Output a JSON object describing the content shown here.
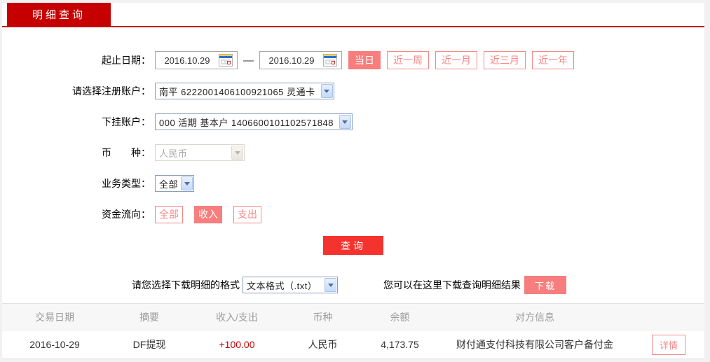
{
  "colors": {
    "tab_red": "#c60001",
    "query_red": "#f5332e",
    "salmon": "#f87e7e",
    "amount_red": "#c00000",
    "header_gray": "#9c9c9c"
  },
  "tab": {
    "label": "明细查询"
  },
  "form": {
    "date_range": {
      "label": "起止日期：",
      "start": "2016.10.29",
      "end": "2016.10.29",
      "separator": "—",
      "quick_buttons": [
        {
          "label": "当日",
          "active": true
        },
        {
          "label": "近一周",
          "active": false
        },
        {
          "label": "近一月",
          "active": false
        },
        {
          "label": "近三月",
          "active": false
        },
        {
          "label": "近一年",
          "active": false
        }
      ]
    },
    "register_account": {
      "label": "请选择注册账户：",
      "value": "南平 6222001406100921065 灵通卡"
    },
    "sub_account": {
      "label": "下挂账户：",
      "value": "000 活期 基本户 1406600101102571848"
    },
    "currency": {
      "label": "币　　种：",
      "value": "人民币",
      "disabled": true
    },
    "business_type": {
      "label": "业务类型：",
      "value": "全部"
    },
    "fund_flow": {
      "label": "资金流向：",
      "options": [
        {
          "label": "全部",
          "active": false
        },
        {
          "label": "收入",
          "active": true
        },
        {
          "label": "支出",
          "active": false
        }
      ]
    },
    "query_button": "查询"
  },
  "download": {
    "format_label": "请您选择下载明细的格式",
    "format_value": "文本格式（.txt）",
    "hint": "您可以在这里下载查询明细结果",
    "button": "下载"
  },
  "table": {
    "headers": [
      "交易日期",
      "摘要",
      "收入/支出",
      "币种",
      "余额",
      "对方信息"
    ],
    "rows": [
      {
        "date": "2016-10-29",
        "summary": "DF提现",
        "amount": "+100.00",
        "currency": "人民币",
        "balance": "4,173.75",
        "counterparty": "财付通支付科技有限公司客户备付金",
        "action": "详情"
      }
    ]
  }
}
